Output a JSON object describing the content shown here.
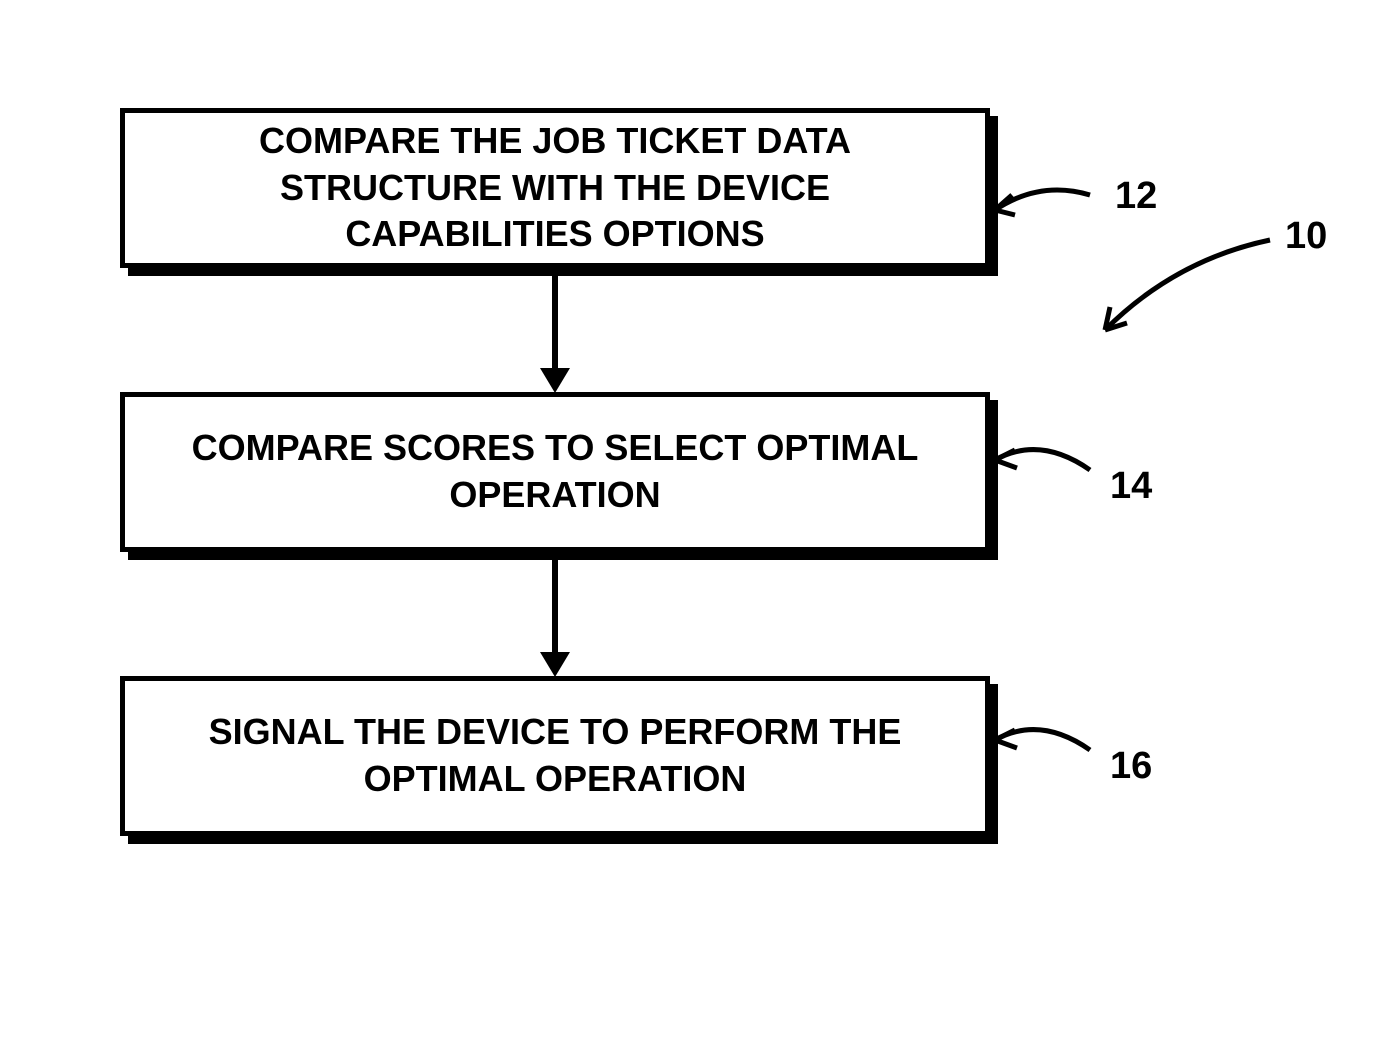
{
  "flowchart": {
    "boxes": [
      {
        "id": "box1",
        "text": "COMPARE THE JOB TICKET DATA STRUCTURE WITH THE DEVICE CAPABILITIES OPTIONS",
        "label": "12"
      },
      {
        "id": "box2",
        "text": "COMPARE SCORES TO SELECT OPTIMAL OPERATION",
        "label": "14"
      },
      {
        "id": "box3",
        "text": "SIGNAL THE DEVICE TO PERFORM THE OPTIMAL OPERATION",
        "label": "16"
      }
    ],
    "diagram_label": "10"
  }
}
